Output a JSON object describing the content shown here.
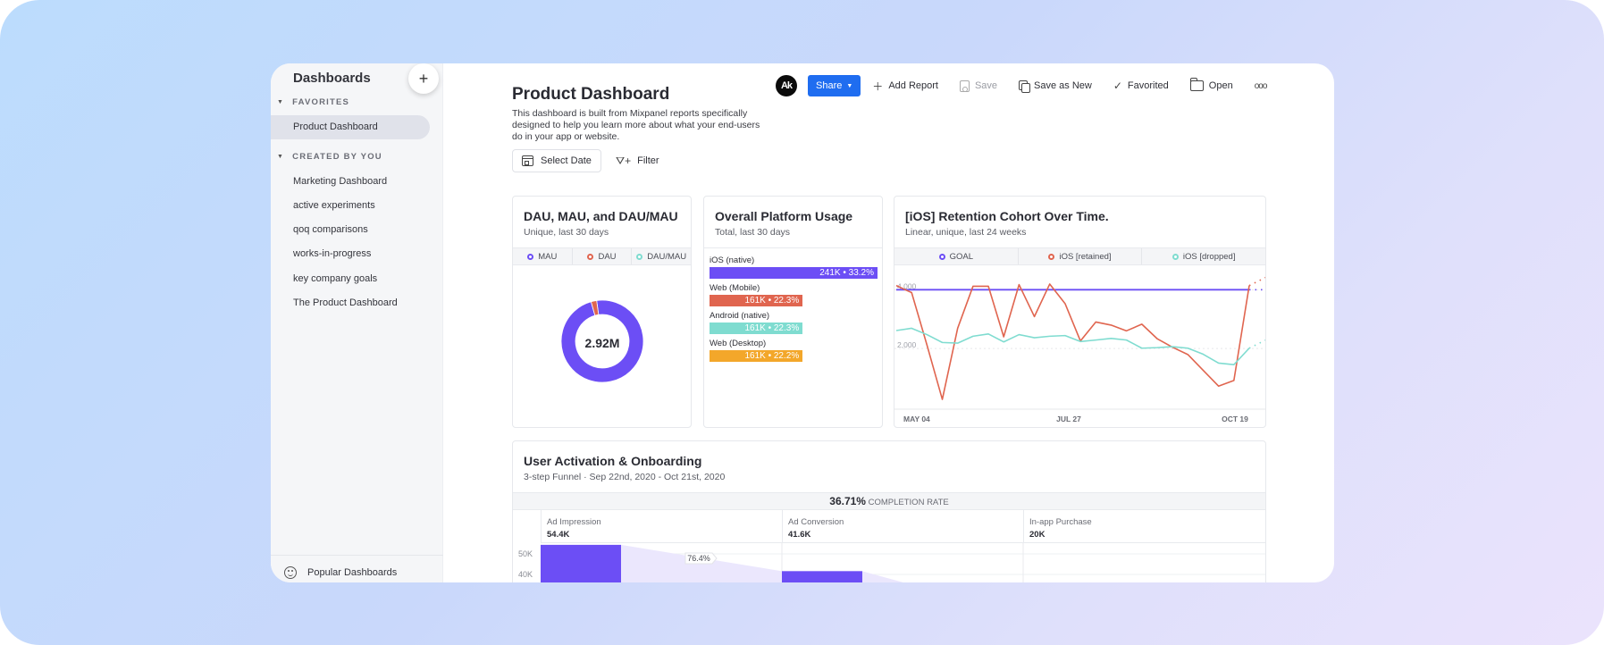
{
  "colors": {
    "purple": "#6c4ef5",
    "red": "#e0654f",
    "teal": "#7fdcd0",
    "orange": "#f3a72a",
    "share_blue": "#1f6df0"
  },
  "sidebar": {
    "title": "Dashboards",
    "add_icon": "+",
    "favorites_label": "FAVORITES",
    "favorites": [
      {
        "label": "Product Dashboard",
        "active": true
      }
    ],
    "created_label": "CREATED BY YOU",
    "created": [
      {
        "label": "Marketing Dashboard"
      },
      {
        "label": "active experiments"
      },
      {
        "label": "qoq comparisons"
      },
      {
        "label": "works-in-progress"
      },
      {
        "label": "key company goals"
      },
      {
        "label": "The Product Dashboard"
      }
    ],
    "footer_label": "Popular Dashboards"
  },
  "header": {
    "title": "Product Dashboard",
    "description": "This dashboard is built from Mixpanel reports specifically designed to help you learn more about what your end-users do in your app or website.",
    "select_date": "Select Date",
    "filter": "Filter"
  },
  "toolbar": {
    "avatar_initials": "Ak",
    "share": "Share",
    "add_report": "Add Report",
    "save": "Save",
    "save_as_new": "Save as New",
    "favorited": "Favorited",
    "open": "Open",
    "more": "ooo"
  },
  "cards": {
    "dau": {
      "title": "DAU, MAU, and DAU/MAU",
      "subtitle": "Unique, last 30 days",
      "legend": [
        "MAU",
        "DAU",
        "DAU/MAU"
      ],
      "center_value": "2.92M"
    },
    "platform": {
      "title": "Overall Platform Usage",
      "subtitle": "Total, last 30 days"
    },
    "retention": {
      "title": "[iOS] Retention Cohort Over Time.",
      "subtitle": "Linear, unique, last 24 weeks",
      "legend": [
        "GOAL",
        "iOS [retained]",
        "iOS [dropped]"
      ]
    },
    "funnel": {
      "title": "User Activation & Onboarding",
      "subtitle": "3-step Funnel · Sep 22nd, 2020 - Oct 21st, 2020",
      "completion_value": "36.71%",
      "completion_label": "COMPLETION RATE",
      "steps": [
        {
          "name": "Ad Impression",
          "value": "54.4K"
        },
        {
          "name": "Ad Conversion",
          "value": "41.6K"
        },
        {
          "name": "In-app Purchase",
          "value": "20K"
        }
      ],
      "conversion_label": "76.4%"
    }
  },
  "chart_data": [
    {
      "type": "pie",
      "title": "DAU, MAU, and DAU/MAU",
      "center_label": "2.92M",
      "labels": [
        "MAU",
        "DAU",
        "DAU/MAU"
      ],
      "values": [
        97.8,
        2.2,
        0
      ],
      "colors": [
        "#6c4ef5",
        "#e0654f",
        "#7fdcd0"
      ]
    },
    {
      "type": "bar",
      "title": "Overall Platform Usage",
      "categories": [
        "iOS (native)",
        "Web (Mobile)",
        "Android (native)",
        "Web (Desktop)"
      ],
      "values": [
        241000,
        161000,
        161000,
        161000
      ],
      "display_values": [
        "241K",
        "161K",
        "161K",
        "161K"
      ],
      "percents": [
        "33.2%",
        "22.3%",
        "22.3%",
        "22.2%"
      ],
      "colors": [
        "#6c4ef5",
        "#e0654f",
        "#7fdcd0",
        "#f3a72a"
      ]
    },
    {
      "type": "line",
      "title": "[iOS] Retention Cohort Over Time.",
      "x_ticks": [
        "MAY 04",
        "JUL 27",
        "OCT 19"
      ],
      "y_ticks": [
        "2,000",
        "4,000"
      ],
      "ylim": [
        0,
        4800
      ],
      "series": [
        {
          "name": "GOAL",
          "color": "#6c4ef5",
          "values": [
            4000,
            4000,
            4000,
            4000,
            4000,
            4000,
            4000,
            4000,
            4000,
            4000,
            4000,
            4000,
            4000,
            4000,
            4000,
            4000,
            4000,
            4000,
            4000,
            4000,
            4000,
            4000,
            4000,
            4000
          ]
        },
        {
          "name": "iOS [retained]",
          "color": "#e0654f",
          "values": [
            4142,
            3903,
            2120,
            271,
            2690,
            4119,
            4119,
            2400,
            4174,
            3087,
            4194,
            3529,
            2258,
            2903,
            2797,
            2603,
            2829,
            2335,
            2045,
            1797,
            1258,
            722,
            915,
            4142
          ]
        },
        {
          "name": "iOS [dropped]",
          "color": "#7fdcd0",
          "values": [
            2613,
            2690,
            2474,
            2206,
            2184,
            2419,
            2497,
            2226,
            2474,
            2367,
            2419,
            2442,
            2239,
            2290,
            2345,
            2290,
            2013,
            2032,
            2065,
            2013,
            1806,
            1506,
            1452,
            2013
          ]
        }
      ]
    },
    {
      "type": "bar",
      "title": "User Activation & Onboarding",
      "categories": [
        "Ad Impression",
        "Ad Conversion",
        "In-app Purchase"
      ],
      "values": [
        54400,
        41600,
        20000
      ],
      "y_ticks": [
        "50K",
        "40K"
      ],
      "conversion": "76.4%",
      "completion_rate": "36.71%"
    }
  ]
}
